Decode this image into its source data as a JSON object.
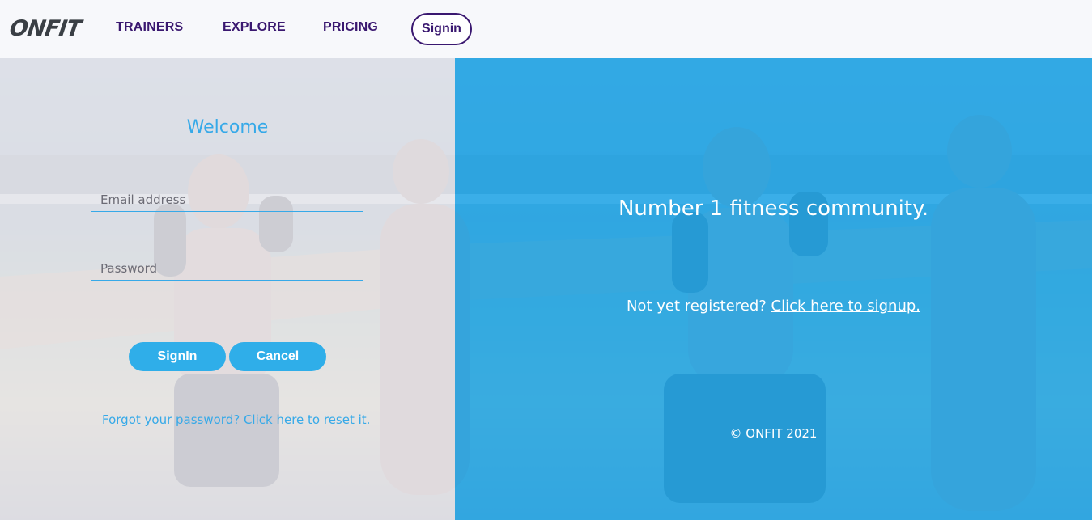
{
  "nav": {
    "logo": "ONFIT",
    "links": [
      "TRAINERS",
      "EXPLORE",
      "PRICING"
    ],
    "signin_label": "Signin"
  },
  "login": {
    "title": "Welcome",
    "email_placeholder": "Email address",
    "email_value": "",
    "password_placeholder": "Password",
    "password_value": "",
    "signin_label": "SignIn",
    "cancel_label": "Cancel",
    "forgot_text": "Forgot your password? Click here to reset it."
  },
  "promo": {
    "tagline": "Number 1 fitness community.",
    "register_prompt": "Not yet registered?",
    "register_link": "Click here to signup.",
    "copyright": "© ONFIT 2021"
  },
  "colors": {
    "accent": "#2faee9",
    "nav_text": "#3a1870",
    "right_panel": "#26aaec"
  }
}
